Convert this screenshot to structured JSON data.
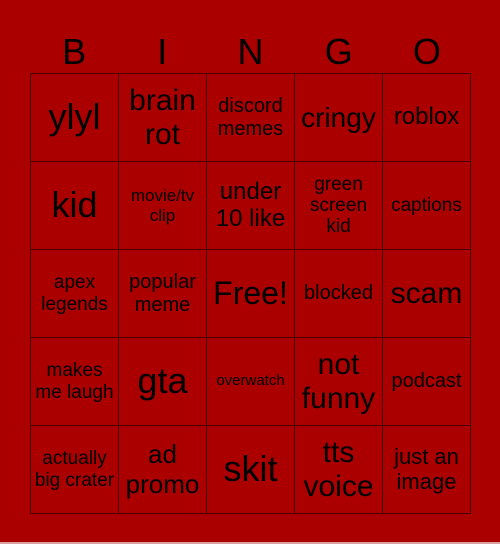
{
  "header": [
    "B",
    "I",
    "N",
    "G",
    "O"
  ],
  "cells": [
    [
      "ylyl",
      "brain rot",
      "discord memes",
      "cringy",
      "roblox"
    ],
    [
      "kid",
      "movie/tv clip",
      "under 10 like",
      "green screen kid",
      "captions"
    ],
    [
      "apex legends",
      "popular meme",
      "Free!",
      "blocked",
      "scam"
    ],
    [
      "makes me laugh",
      "gta",
      "overwatch",
      "not funny",
      "podcast"
    ],
    [
      "actually big crater",
      "ad promo",
      "skit",
      "tts voice",
      "just an image"
    ]
  ],
  "colors": {
    "background": "#ab0000",
    "text": "#000000",
    "grid_line": "#4a0000"
  }
}
